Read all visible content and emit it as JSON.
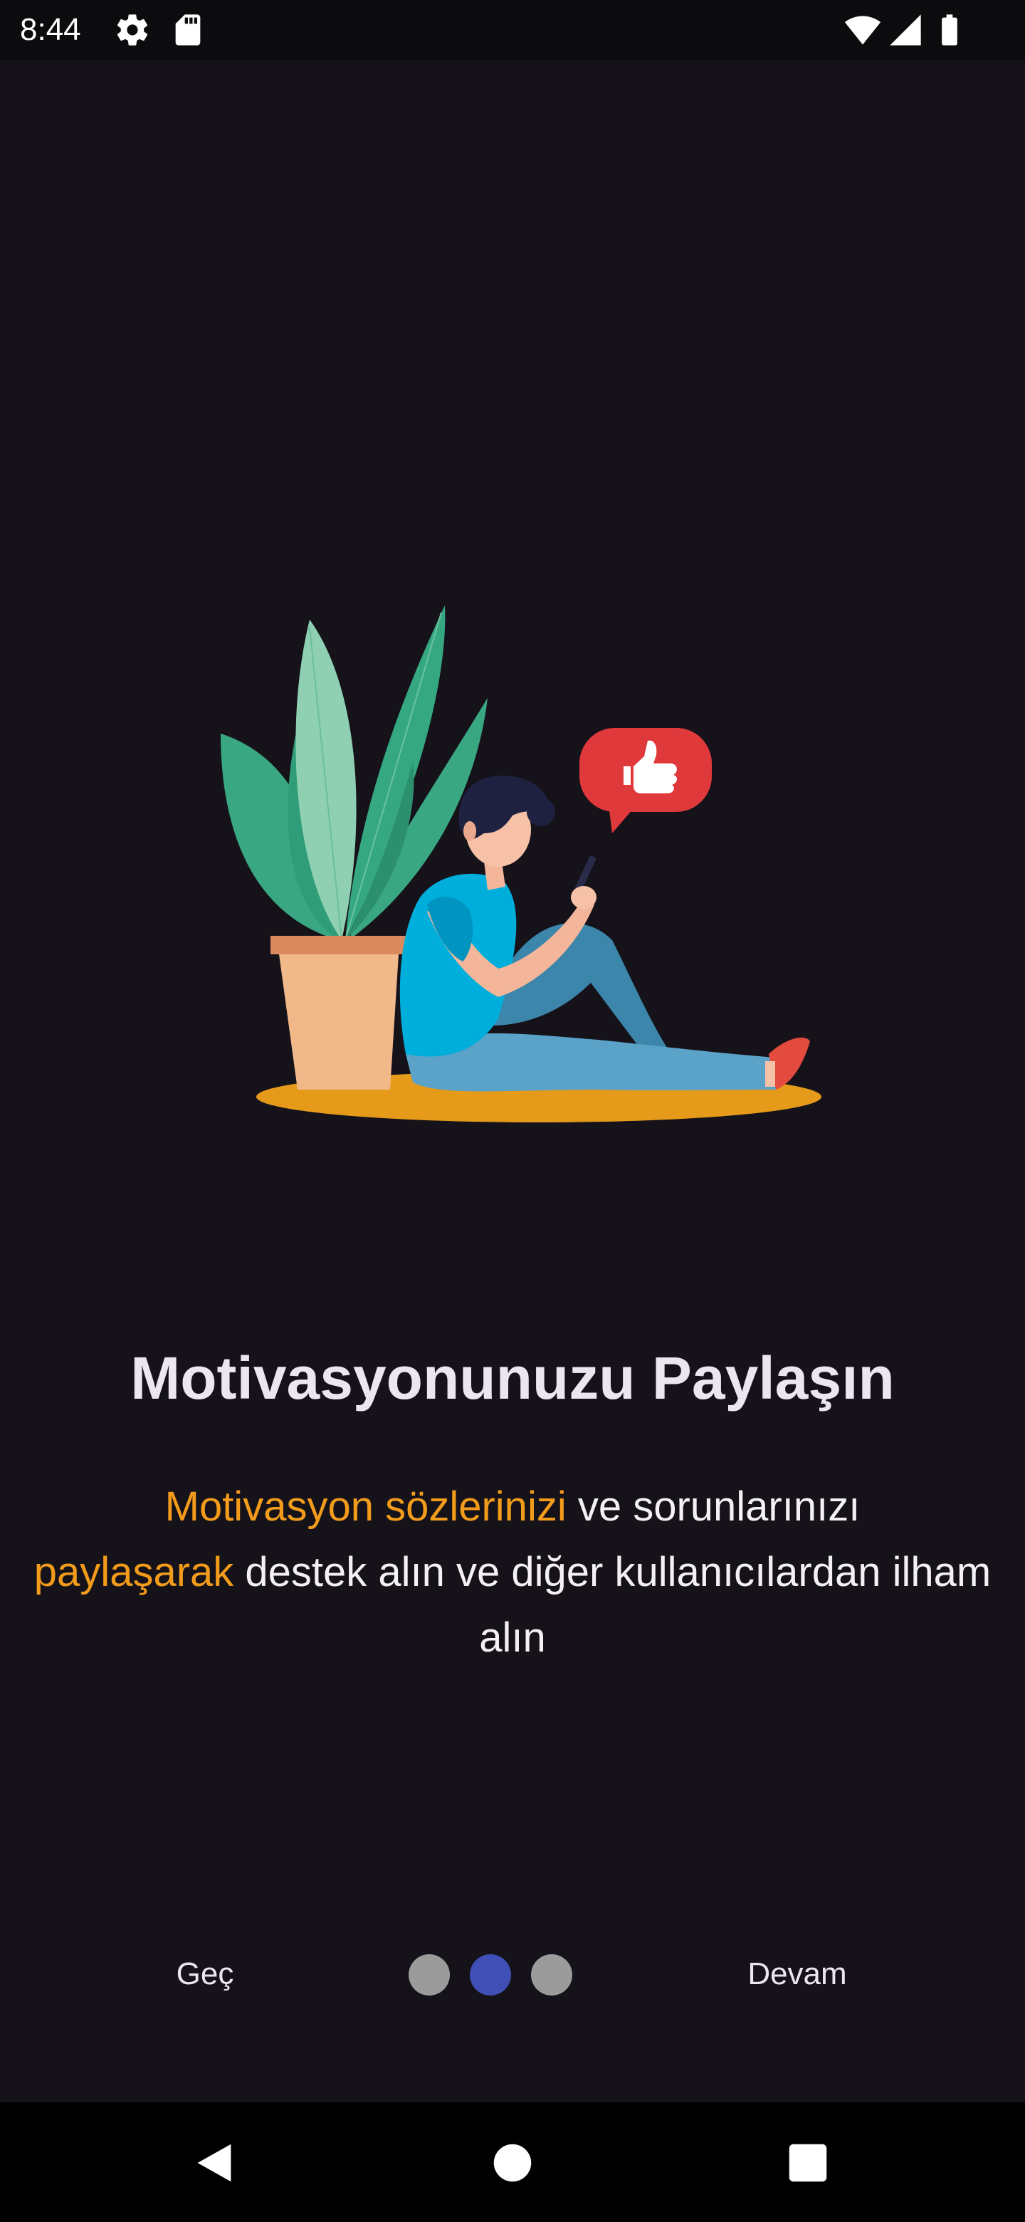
{
  "status_bar": {
    "time": "8:44",
    "icons": [
      "gear-icon",
      "sd-card-icon",
      "wifi-icon",
      "cellular-signal-icon",
      "battery-icon"
    ]
  },
  "onboarding": {
    "illustration": "person-with-plant-and-like-bubble",
    "title": "Motivasyonunuzu Paylaşın",
    "description": {
      "line1_highlight": "Motivasyon sözlerinizi",
      "line1_rest": " ve sorunlarınızı",
      "line2_highlight": "paylaşarak",
      "line2_rest": " destek alın ve diğer kullanıcılardan ilham alın"
    },
    "colors": {
      "highlight": "#f39c1b",
      "active_dot": "#3f4fb6",
      "inactive_dot": "#9b9b9b",
      "background": "#15121a"
    }
  },
  "controls": {
    "skip_label": "Geç",
    "next_label": "Devam",
    "page_count": 3,
    "active_page": 2
  },
  "nav_bar": {
    "icons": [
      "back-icon",
      "home-icon",
      "recents-icon"
    ]
  }
}
